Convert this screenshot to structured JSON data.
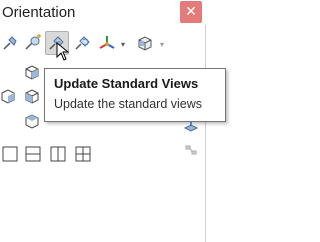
{
  "panel": {
    "title": "Orientation",
    "close_glyph": "✕"
  },
  "toolbar": {
    "buttons": [
      {
        "icon": "pin-icon"
      },
      {
        "icon": "new-view-icon"
      },
      {
        "icon": "update-standard-views-icon",
        "active": true
      },
      {
        "icon": "reset-standard-views-icon"
      },
      {
        "icon": "view-selector-icon"
      },
      {
        "icon": "cube-view-icon"
      }
    ],
    "dropdown_glyph": "▾"
  },
  "tooltip": {
    "title": "Update Standard Views",
    "description": "Update the standard views"
  },
  "colors": {
    "close_bg": "#e37b7b",
    "tooltip_border": "#767676",
    "accent_blue": "#3a78c9"
  }
}
